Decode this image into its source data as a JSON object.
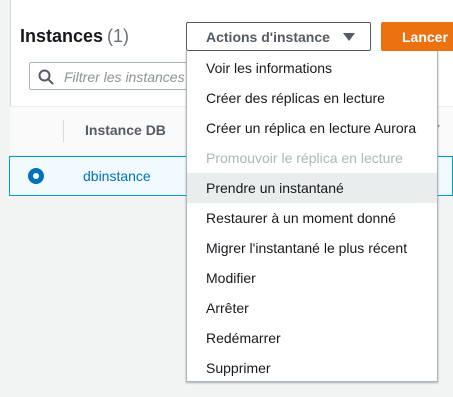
{
  "header": {
    "title": "Instances",
    "count": "(1)",
    "actions_label": "Actions d'instance",
    "launch_label": "Lancer"
  },
  "search": {
    "placeholder": "Filtrer les instances"
  },
  "table": {
    "columns": [
      "Instance DB"
    ],
    "rows": [
      {
        "selected": true,
        "name": "dbinstance"
      }
    ]
  },
  "menu": {
    "items": [
      {
        "label": "Voir les informations",
        "disabled": false
      },
      {
        "label": "Créer des réplicas en lecture",
        "disabled": false
      },
      {
        "label": "Créer un réplica en lecture Aurora",
        "disabled": false
      },
      {
        "label": "Promouvoir le réplica en lecture",
        "disabled": true
      },
      {
        "label": "Prendre un instantané",
        "disabled": false,
        "hover": true
      },
      {
        "label": "Restaurer à un moment donné",
        "disabled": false
      },
      {
        "label": "Migrer l'instantané le plus récent",
        "disabled": false
      },
      {
        "label": "Modifier",
        "disabled": false
      },
      {
        "label": "Arrêter",
        "disabled": false
      },
      {
        "label": "Redémarrer",
        "disabled": false
      },
      {
        "label": "Supprimer",
        "disabled": false
      }
    ]
  },
  "colors": {
    "accent": "#ec7211",
    "link": "#0073bb",
    "selected_border": "#00a1c9"
  }
}
